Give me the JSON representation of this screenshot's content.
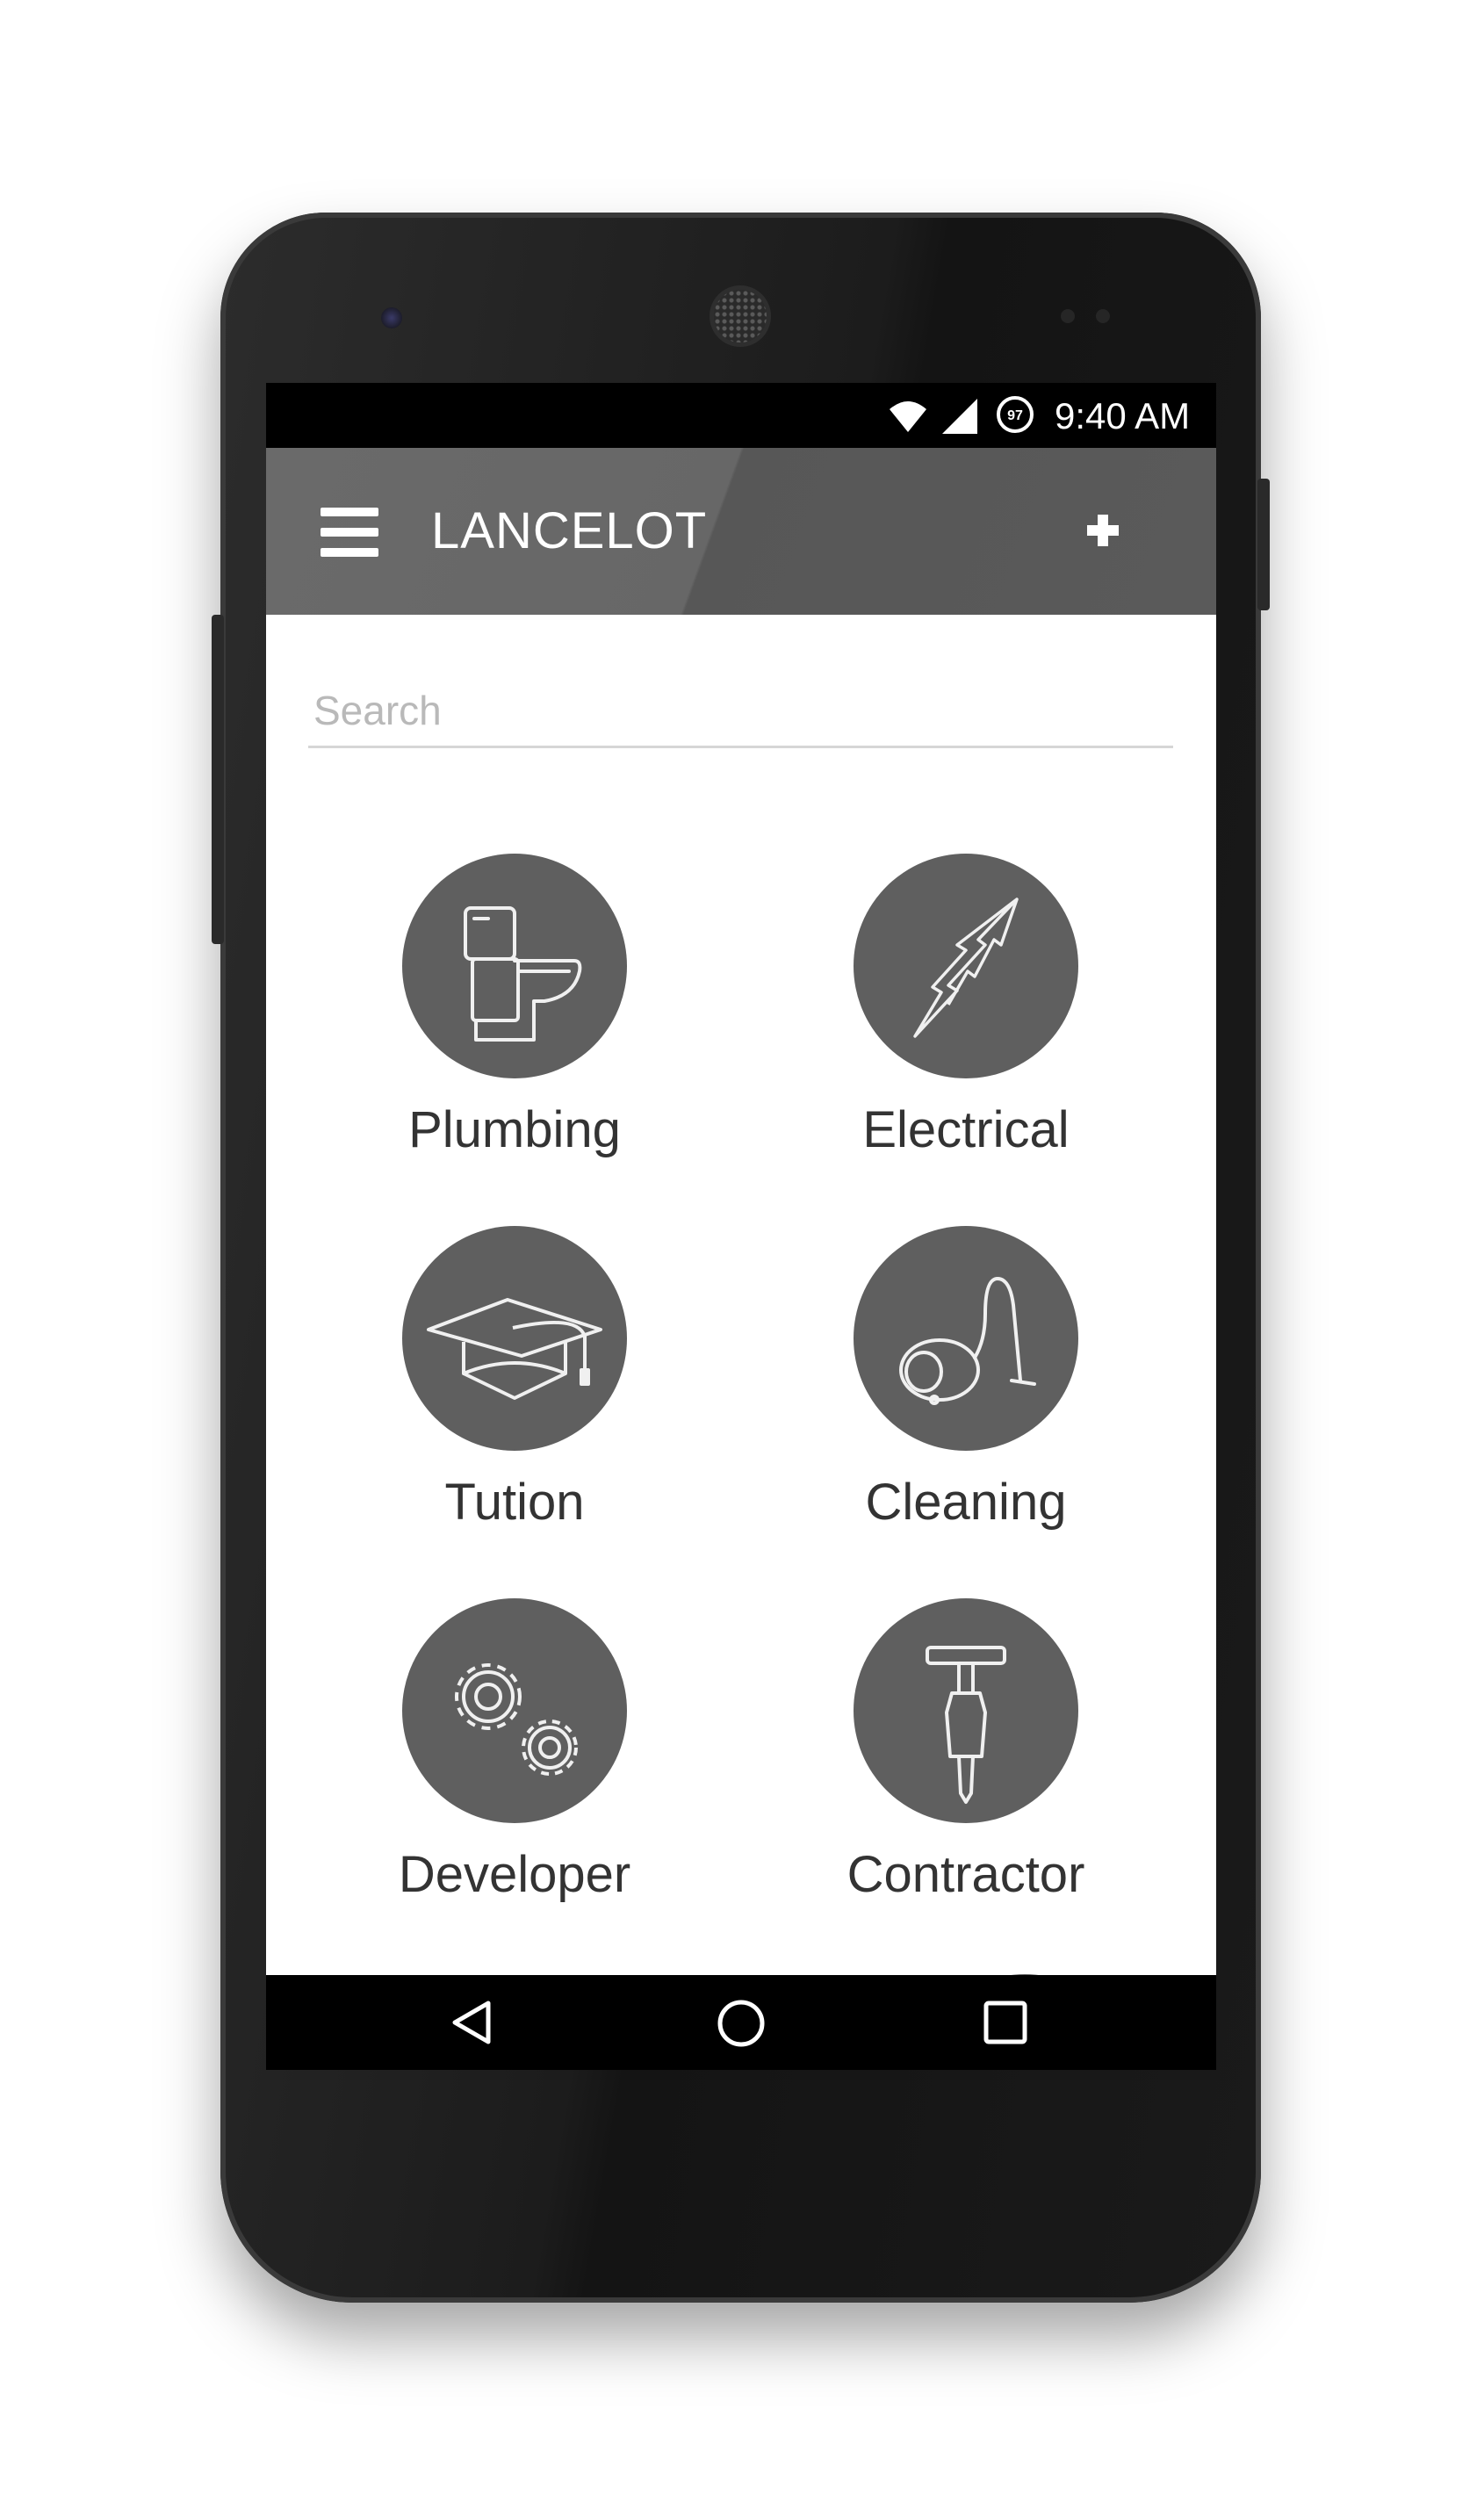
{
  "status_bar": {
    "time": "9:40 AM",
    "battery_level": "97",
    "icons": [
      "wifi-icon",
      "signal-icon",
      "battery-saver-icon"
    ]
  },
  "app_bar": {
    "title": "LANCELOT",
    "menu_icon": "hamburger-menu-icon",
    "action_icon": "plus-icon",
    "background_color": "#676767"
  },
  "search": {
    "placeholder": "Search",
    "value": ""
  },
  "categories": [
    {
      "label": "Plumbing",
      "icon": "toilet-icon"
    },
    {
      "label": "Electrical",
      "icon": "lightning-icon"
    },
    {
      "label": "Tution",
      "icon": "graduation-cap-icon"
    },
    {
      "label": "Cleaning",
      "icon": "vacuum-cleaner-icon"
    },
    {
      "label": "Developer",
      "icon": "gears-icon"
    },
    {
      "label": "Contractor",
      "icon": "jackhammer-icon"
    }
  ],
  "colors": {
    "tile_circle": "#5f5f5f",
    "label_text": "#333333"
  },
  "nav_bar": {
    "icons": [
      "back-icon",
      "home-icon",
      "recents-icon"
    ]
  }
}
